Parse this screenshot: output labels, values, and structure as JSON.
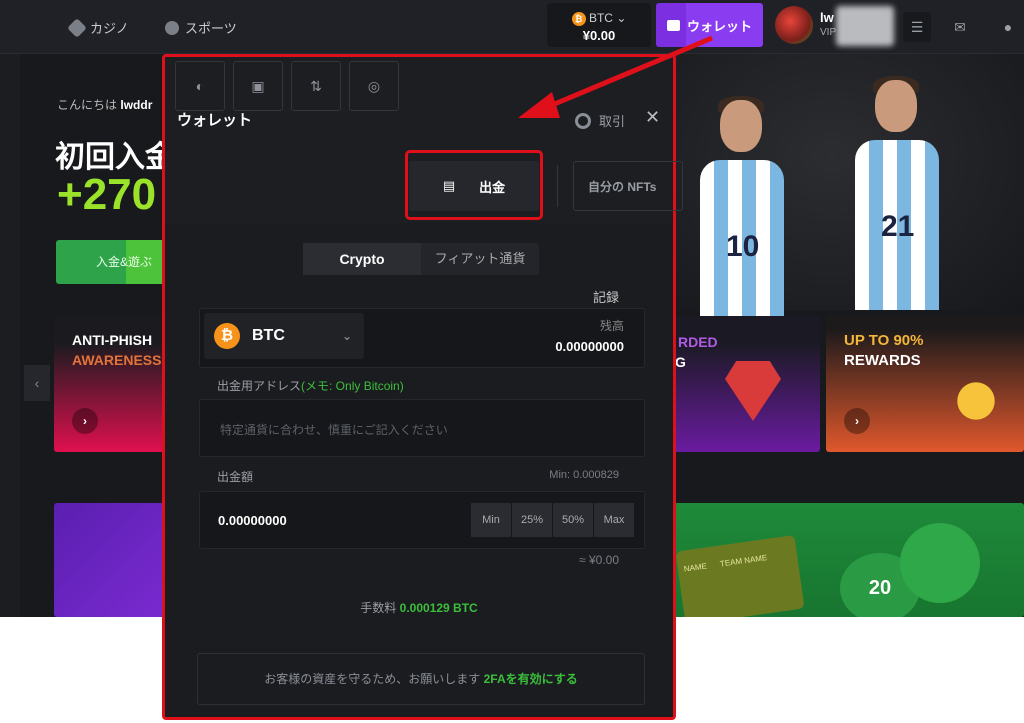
{
  "topbar": {
    "nav": [
      {
        "label": "カジノ",
        "icon": "diamond-icon"
      },
      {
        "label": "スポーツ",
        "icon": "sports-icon"
      }
    ],
    "balance": {
      "currency": "BTC",
      "amount": "¥0.00"
    },
    "wallet_label": "ウォレット",
    "user": {
      "name": "lw",
      "level": "VIP"
    }
  },
  "hero": {
    "greeting": "こんにちは",
    "username": "lwddr",
    "headline": "初回入金",
    "bonus": "+270",
    "cta": "入金&遊ぶ"
  },
  "promos": [
    {
      "line1": "ANTI-PHISH",
      "line2": "AWARENESS"
    },
    {
      "line1": "RDED",
      "line2": "G"
    },
    {
      "line1": "UP TO",
      "highlight": "90%",
      "line2": "REWARDS"
    }
  ],
  "player_numbers": [
    "10",
    "21"
  ],
  "sports_banner": {
    "team1": "NAME",
    "team2": "TEAM NAME",
    "jersey": "20"
  },
  "modal": {
    "title": "ウォレット",
    "trade_label": "取引",
    "tabs": [
      {
        "icon": "piggy-bank-icon"
      },
      {
        "icon": "cash-icon"
      },
      {
        "icon": "swap-icon"
      },
      {
        "icon": "vault-icon"
      },
      {
        "icon": "withdraw-icon",
        "label": "出金",
        "active": true
      }
    ],
    "nft_label": "自分の NFTs",
    "segments": [
      "Crypto",
      "フィアット通貨"
    ],
    "records": "記録",
    "coin": "BTC",
    "balance_label": "残高",
    "balance_value": "0.00000000",
    "address_label": "出金用アドレス",
    "memo": "(メモ:  Only Bitcoin)",
    "address_placeholder": "特定通貨に合わせ、慎重にご記入ください",
    "amount_label": "出金額",
    "min_label": "Min: 0.000829",
    "amount_value": "0.00000000",
    "quick": [
      "Min",
      "25%",
      "50%",
      "Max"
    ],
    "fiat_estimate": "≈ ¥0.00",
    "fee_label": "手数料",
    "fee_value": "0.000129 BTC",
    "twofa_text": "お客様の資産を守るため、お願いします",
    "twofa_link": "2FAを有効にする"
  },
  "colors": {
    "accent": "#8a3cf0",
    "green": "#3bbf3b",
    "annotation": "#e0101a",
    "btc": "#f7931a"
  }
}
